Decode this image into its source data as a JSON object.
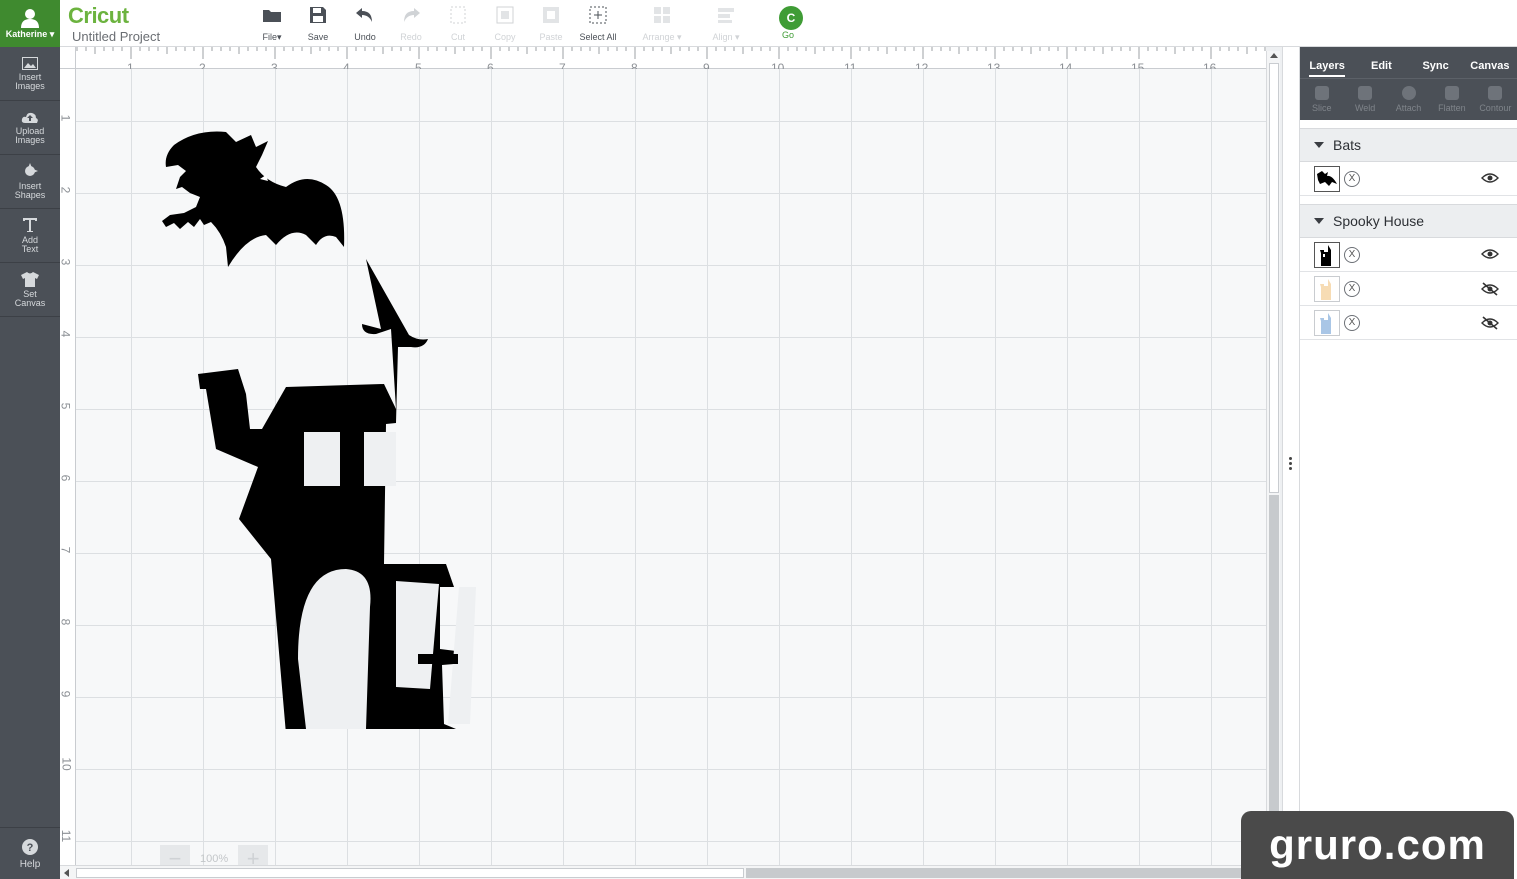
{
  "user": {
    "name": "Katherine"
  },
  "sidebar": {
    "items": [
      {
        "label1": "Insert",
        "label2": "Images",
        "icon": "image-icon"
      },
      {
        "label1": "Upload",
        "label2": "Images",
        "icon": "cloud-upload-icon"
      },
      {
        "label1": "Insert",
        "label2": "Shapes",
        "icon": "shapes-icon"
      },
      {
        "label1": "Add",
        "label2": "Text",
        "icon": "text-icon"
      },
      {
        "label1": "Set",
        "label2": "Canvas",
        "icon": "shirt-icon"
      }
    ],
    "help": "Help"
  },
  "header": {
    "logo": "Cricut",
    "project_title": "Untitled Project",
    "tools": {
      "file": "File",
      "save": "Save",
      "undo": "Undo",
      "redo": "Redo",
      "cut": "Cut",
      "copy": "Copy",
      "paste": "Paste",
      "select_all": "Select All",
      "arrange": "Arrange",
      "align": "Align",
      "go": "Go"
    },
    "go_symbol": "C"
  },
  "canvas": {
    "ruler_top": [
      "1",
      "2",
      "3",
      "4",
      "5",
      "6",
      "7",
      "8",
      "9",
      "10",
      "11",
      "12",
      "13",
      "14",
      "15",
      "16"
    ],
    "ruler_left": [
      "1",
      "2",
      "3",
      "4",
      "5",
      "6",
      "7",
      "8",
      "9",
      "10",
      "11"
    ],
    "zoom": "100%",
    "zoom_minus": "−",
    "zoom_plus": "+"
  },
  "panel": {
    "tabs": [
      "Layers",
      "Edit",
      "Sync",
      "Canvas"
    ],
    "active_tab": "Layers",
    "tools": [
      "Slice",
      "Weld",
      "Attach",
      "Flatten",
      "Contour"
    ],
    "groups": [
      {
        "name": "Bats",
        "layers": [
          {
            "visible": true
          }
        ]
      },
      {
        "name": "Spooky House",
        "layers": [
          {
            "visible": true
          },
          {
            "visible": false
          },
          {
            "visible": false
          }
        ]
      }
    ],
    "x_symbol": "X"
  },
  "watermark": "gruro.com",
  "colors": {
    "brand_green": "#6cb33f",
    "sidebar": "#4b5057",
    "go_green": "#3f9c35"
  }
}
